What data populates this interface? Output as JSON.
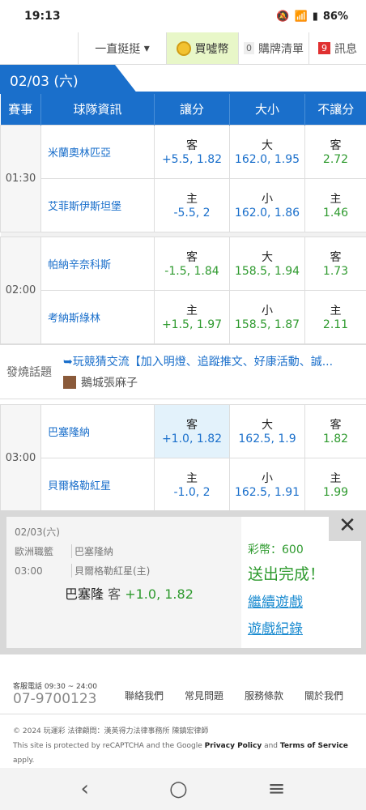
{
  "status": {
    "time": "19:13",
    "battery": "86%"
  },
  "topbar": {
    "dropdown": "一直挺挺",
    "buy": "買噓幣",
    "cart_count": "0",
    "cart": "購牌清單",
    "msg_count": "9",
    "msg": "訊息"
  },
  "date": "02/03 (六)",
  "headers": [
    "賽事",
    "球隊資訊",
    "讓分",
    "大小",
    "不讓分"
  ],
  "matches": [
    {
      "time": "01:30",
      "rows": [
        {
          "team": "米蘭奧林匹亞",
          "h1": "客",
          "h2": "+5.5, 1.82",
          "o1": "大",
          "o2": "162.0, 1.95",
          "m1": "客",
          "m2": "2.72"
        },
        {
          "team": "艾菲斯伊斯坦堡",
          "h1": "主",
          "h2": "-5.5, 2",
          "o1": "小",
          "o2": "162.0, 1.86",
          "m1": "主",
          "m2": "1.46"
        }
      ]
    },
    {
      "time": "02:00",
      "rows": [
        {
          "team": "帕納辛奈科斯",
          "h1": "客",
          "h2": "-1.5, 1.84",
          "o1": "大",
          "o2": "158.5, 1.94",
          "m1": "客",
          "m2": "1.73"
        },
        {
          "team": "考納斯綠林",
          "h1": "主",
          "h2": "+1.5, 1.97",
          "o1": "小",
          "o2": "158.5, 1.87",
          "m1": "主",
          "m2": "2.11"
        }
      ]
    },
    {
      "time": "03:00",
      "rows": [
        {
          "team": "巴塞隆納",
          "h1": "客",
          "h2": "+1.0, 1.82",
          "o1": "大",
          "o2": "162.5, 1.9",
          "m1": "客",
          "m2": "1.82"
        },
        {
          "team": "貝爾格勒紅星",
          "h1": "主",
          "h2": "-1.0, 2",
          "o1": "小",
          "o2": "162.5, 1.91",
          "m1": "主",
          "m2": "1.99"
        }
      ]
    }
  ],
  "hot": {
    "label": "發燒話題",
    "title": "➥玩競猜交流【加入明燈、追蹤推文、好康活動、誠...",
    "user": "鵝城張麻子"
  },
  "popup": {
    "date": "02/03(六)",
    "league": "歐洲職籃",
    "time": "03:00",
    "away": "巴塞隆納",
    "home": "貝爾格勒紅星(主)",
    "pick_team": "巴塞隆",
    "pick_side": "客",
    "pick_odds": "+1.0, 1.82",
    "balance": "彩幣：600",
    "done": "送出完成！",
    "continue": "繼續遊戲",
    "history": "遊戲紀錄",
    "close": "✕"
  },
  "footer": {
    "phone_caption": "客服電話 09:30 ~ 24:00",
    "phone": "07-9700123",
    "links": [
      "聯絡我們",
      "常見問題",
      "服務條款",
      "關於我們"
    ],
    "copy1": "© 2024 玩運彩 法律顧問：漢英得力法律事務所 陳鎮宏律師",
    "copy2a": "This site is protected by reCAPTCHA and the Google ",
    "copy2b": "Privacy Policy",
    "copy2c": " and ",
    "copy2d": "Terms of Service",
    "copy2e": " apply."
  },
  "nav": {
    "back": "‹",
    "home": "○",
    "menu": "≡"
  }
}
